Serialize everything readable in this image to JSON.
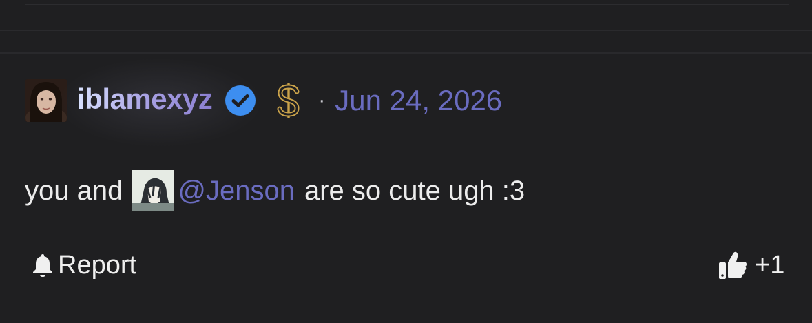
{
  "comment": {
    "username": "iblamexyz",
    "separator": "·",
    "date": "Jun 24, 2026",
    "body_prefix": "you and",
    "mention": "@Jenson",
    "body_suffix": "are so cute ugh :3"
  },
  "footer": {
    "report_label": "Report",
    "like_count": "+1"
  },
  "icons": {
    "verified": "verified-check-icon",
    "dollar": "dollar-badge-icon",
    "report": "bell-icon",
    "like": "thumbs-up-icon"
  },
  "colors": {
    "background": "#1f1f21",
    "accent": "#6a6cc0",
    "verified_blue": "#3d8ef0",
    "gold": "#c9a24a"
  }
}
